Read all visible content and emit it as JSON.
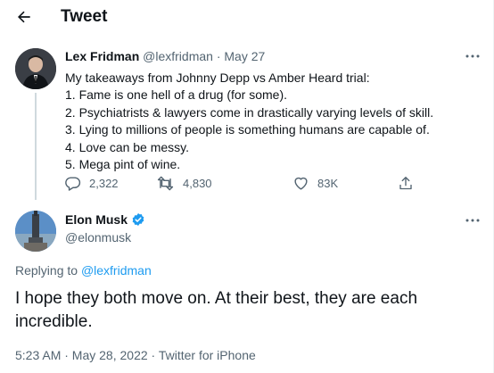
{
  "header": {
    "title": "Tweet"
  },
  "parent_tweet": {
    "name": "Lex Fridman",
    "handle": "@lexfridman",
    "separator": "·",
    "date": "May 27",
    "lines": [
      "My takeaways from Johnny Depp vs Amber Heard trial:",
      "1. Fame is one hell of a drug (for some).",
      "2. Psychiatrists & lawyers come in drastically varying levels of skill.",
      "3. Lying to millions of people is something humans are capable of.",
      "4. Love can be messy.",
      "5. Mega pint of wine."
    ],
    "replies": "2,322",
    "retweets": "4,830",
    "likes": "83K"
  },
  "main_tweet": {
    "name": "Elon Musk",
    "handle": "@elonmusk",
    "replying_prefix": "Replying to",
    "replying_to": "@lexfridman",
    "text": "I hope they both move on. At their best, they are each incredible.",
    "meta": "5:23 AM · May 28, 2022 · Twitter for iPhone"
  },
  "colors": {
    "text": "#0f1419",
    "muted": "#536471",
    "accent": "#1d9bf0",
    "line": "#cfd9de"
  },
  "icons": [
    "back-arrow-icon",
    "more-icon",
    "reply-icon",
    "retweet-icon",
    "like-icon",
    "share-icon",
    "verified-badge-icon"
  ]
}
